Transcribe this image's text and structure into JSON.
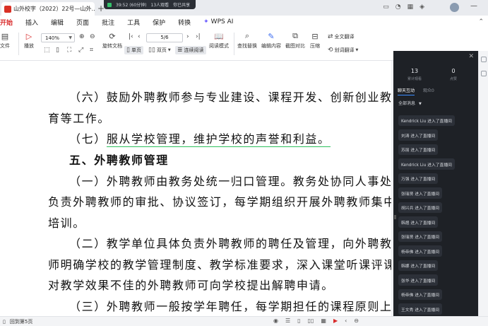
{
  "titlebar": {
    "tab_title": "山外校字（2022）22号—山外…",
    "meeting": {
      "time": "39:52 (60分钟)",
      "attendees": "13人观看",
      "status": "你已共享"
    }
  },
  "menu": {
    "items": [
      "开始",
      "插入",
      "编辑",
      "页面",
      "批注",
      "工具",
      "保护",
      "转换"
    ],
    "active": "开始",
    "wps_ai": "WPS AI"
  },
  "toolbar": {
    "file_menu": "文件",
    "play": "播放",
    "zoom": "140%",
    "rotate": "旋转文档",
    "single_page": "单页",
    "double_page": "双页",
    "continuous": "连续阅读",
    "page_value": "5/6",
    "reading_mode": "阅读模式",
    "find_replace": "查找替换",
    "edit_content": "编辑内容",
    "screenshot_compare": "截图对比",
    "compress": "压缩",
    "full_translate": "全文翻译",
    "word_translate": "划词翻译"
  },
  "document": {
    "paragraphs": [
      {
        "text": "（六）鼓励外聘教师参与专业建设、课程开发、创新创业教",
        "kind": "body"
      },
      {
        "text": "育等工作。",
        "kind": "body"
      },
      {
        "text": "（七）服从学校管理，维护学校的声誉和利益。",
        "kind": "body",
        "highlight": "服从学校管理，维护学校的声誉和利益。"
      },
      {
        "text": "五、外聘教师管理",
        "kind": "heading"
      },
      {
        "text": "（一）外聘教师由教务处统一归口管理。教务处协同人事处",
        "kind": "body"
      },
      {
        "text": "负责外聘教师的审批、协议签订，每学期组织开展外聘教师集中",
        "kind": "body"
      },
      {
        "text": "培训。",
        "kind": "body"
      },
      {
        "text": "（二）教学单位具体负责外聘教师的聘任及管理，向外聘教",
        "kind": "body"
      },
      {
        "text": "师明确学校的教学管理制度、教学标准要求，深入课堂听课评课，",
        "kind": "body"
      },
      {
        "text": "对教学效果不佳的外聘教师可向学校提出解聘申请。",
        "kind": "body"
      },
      {
        "text": "（三）外聘教师一般按学年聘任，每学期担任的课程原则上",
        "kind": "body"
      }
    ],
    "highlight_color": "#2fc05e"
  },
  "side_panel": {
    "stats": [
      {
        "value": "13",
        "label": "累计观看"
      },
      {
        "value": "0",
        "label": "点赞"
      }
    ],
    "tabs": [
      "聊天互动",
      "观众0"
    ],
    "active_tab": "聊天互动",
    "filter": "全部消息",
    "messages": [
      "Kendrick Liu 进入了直播间",
      "刘涛 进入了直播间",
      "苏丽 进入了直播间",
      "Kendrick Liu 进入了直播间",
      "万强 进入了直播间",
      "张瑞贤 进入了直播间",
      "胡兴兵 进入了直播间",
      "韩煜 进入了直播间",
      "张瑞贤 进入了直播间",
      "杨帝佛 进入了直播间",
      "韩娜 进入了直播间",
      "张华 进入了直播间",
      "杨帝佛 进入了直播间",
      "王文秀 进入了直播间"
    ]
  },
  "statusbar": {
    "page_jump": "回到第5页"
  },
  "colors": {
    "accent": "#d92b2b",
    "panel_bg": "#1e2126",
    "meeting_bar": "#2b2f36"
  }
}
